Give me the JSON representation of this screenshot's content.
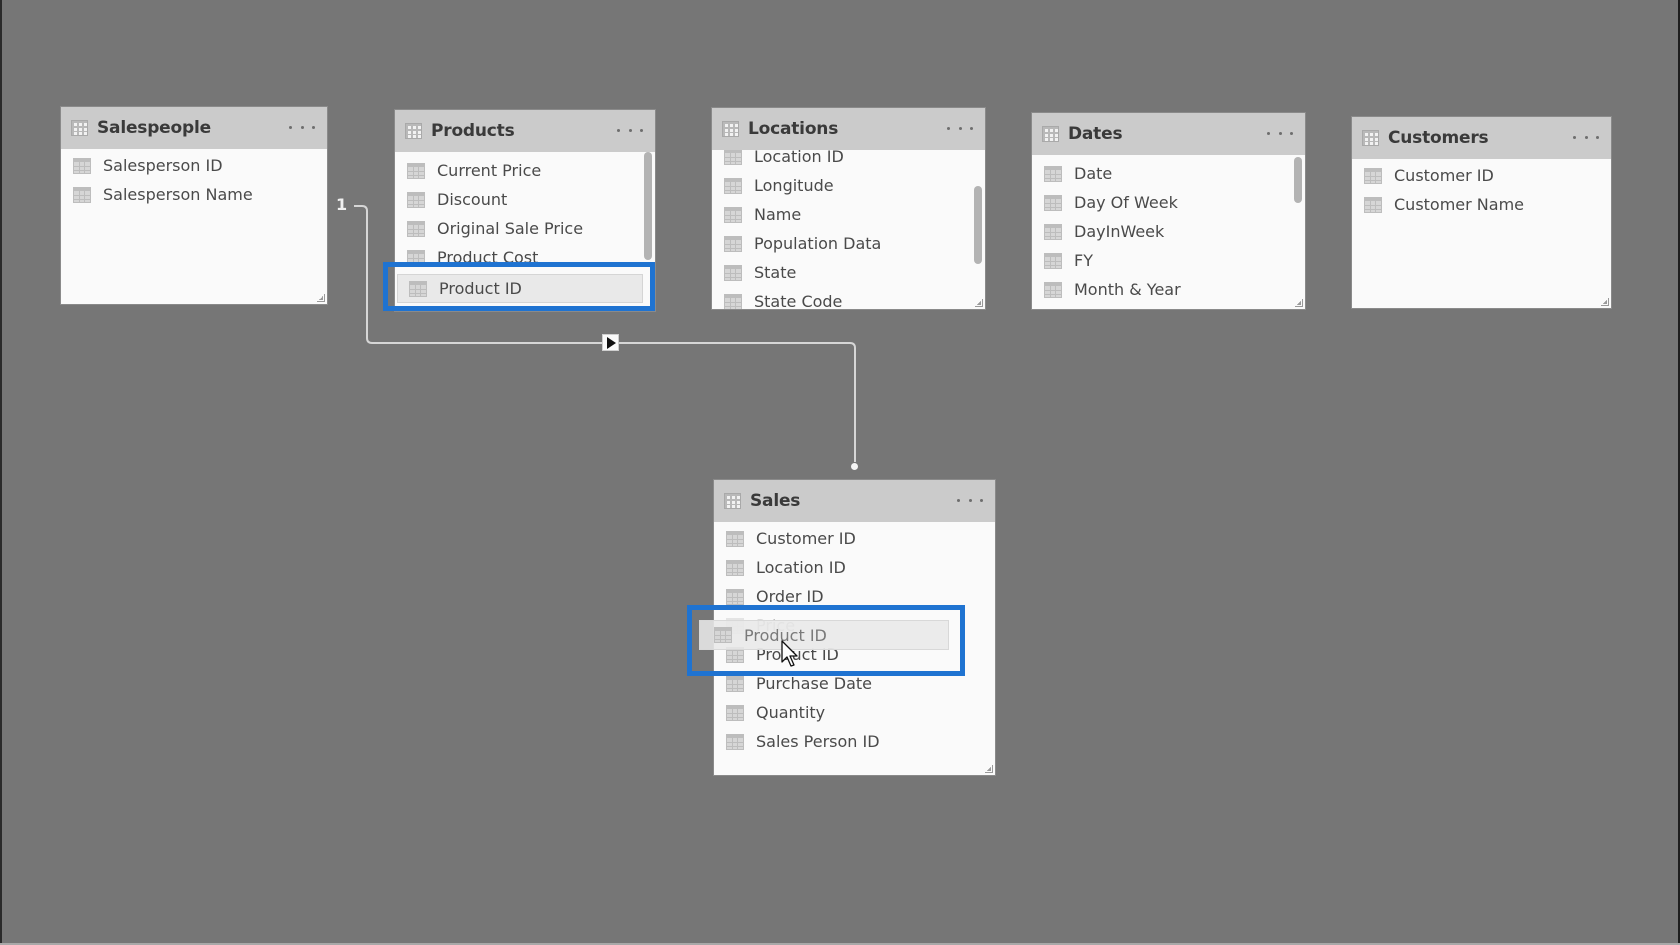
{
  "canvas": {
    "background_color": "#767676",
    "highlight_color": "#1f73d1"
  },
  "tables": {
    "salespeople": {
      "title": "Salespeople",
      "fields": [
        "Salesperson ID",
        "Salesperson Name"
      ]
    },
    "products": {
      "title": "Products",
      "fields": [
        "Current Price",
        "Discount",
        "Original Sale Price",
        "Product Cost",
        "Product ID"
      ],
      "selected_field": "Product ID"
    },
    "locations": {
      "title": "Locations",
      "fields": [
        "Location ID",
        "Longitude",
        "Name",
        "Population Data",
        "State",
        "State Code"
      ]
    },
    "dates": {
      "title": "Dates",
      "fields": [
        "Date",
        "Day Of Week",
        "DayInWeek",
        "FY",
        "Month & Year"
      ]
    },
    "customers": {
      "title": "Customers",
      "fields": [
        "Customer ID",
        "Customer Name"
      ]
    },
    "sales": {
      "title": "Sales",
      "fields": [
        "Customer ID",
        "Location ID",
        "Order ID",
        "Price",
        "Product ID",
        "Purchase Date",
        "Quantity",
        "Sales Person ID"
      ]
    }
  },
  "relationship": {
    "from_table": "Products",
    "to_table": "Sales",
    "one_side_label": "1",
    "many_side_marker": "*",
    "cross_filter_direction": "single"
  },
  "drag": {
    "dragged_field_label": "Product ID",
    "drop_target_field": "Product ID"
  },
  "icons": {
    "table": "table-grid-icon",
    "column": "column-icon",
    "more": "ellipsis-icon",
    "cross_filter": "arrow-right-icon",
    "cursor": "mouse-pointer-icon"
  }
}
